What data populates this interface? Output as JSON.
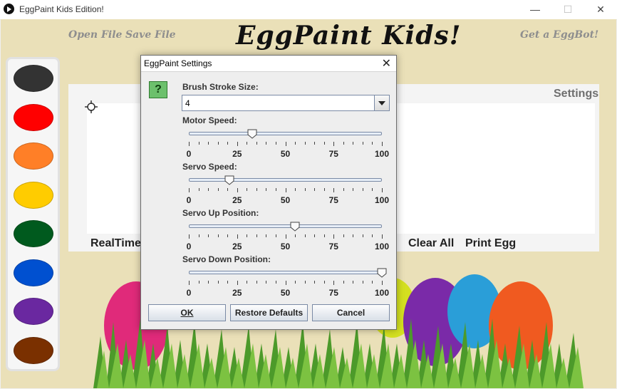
{
  "window": {
    "title": "EggPaint Kids Edition!"
  },
  "app": {
    "open_file": "Open File",
    "save_file": "Save File",
    "heading": "EggPaint Kids!",
    "get_eggbot": "Get a EggBot!",
    "settings": "Settings",
    "realtime": "RealTime: O",
    "clear_all": "Clear All",
    "print_egg": "Print Egg"
  },
  "palette": {
    "colors": [
      "#333333",
      "#ff0000",
      "#ff7f27",
      "#ffcc00",
      "#005a1e",
      "#0050d0",
      "#6a28a0",
      "#7a3000"
    ]
  },
  "dialog": {
    "title": "EggPaint Settings",
    "brush": {
      "label": "Brush Stroke Size:",
      "value": "4"
    },
    "sliders": [
      {
        "label": "Motor Speed:",
        "value": 33
      },
      {
        "label": "Servo Speed:",
        "value": 21
      },
      {
        "label": "Servo Up Position:",
        "value": 55
      },
      {
        "label": "Servo Down Position:",
        "value": 100
      }
    ],
    "tick_labels": [
      "0",
      "25",
      "50",
      "75",
      "100"
    ],
    "buttons": {
      "ok": "OK",
      "restore": "Restore Defaults",
      "cancel": "Cancel"
    }
  }
}
